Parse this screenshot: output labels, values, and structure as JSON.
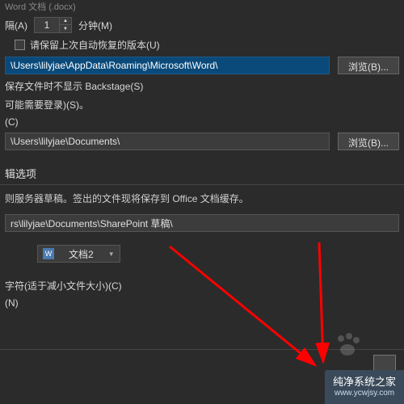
{
  "top_truncated": "Word 文档 (.docx)",
  "interval": {
    "label_left": "隔(A)",
    "value": "1",
    "label_right": "分钟(M)"
  },
  "keep_last_autorecover": "请保留上次自动恢复的版本(U)",
  "path1": "\\Users\\lilyjae\\AppData\\Roaming\\Microsoft\\Word\\",
  "browse_label": "浏览(B)...",
  "dont_show_backstage": "保存文件时不显示 Backstage(S)",
  "may_need_login": "可能需要登录)(S)。",
  "location_c": "(C)",
  "path2": "\\Users\\lilyjae\\Documents\\",
  "section_header": "辑选项",
  "section_text": "则服务器草稿。签出的文件现将保存到 Office 文档缓存。",
  "path3": "rs\\lilyjae\\Documents\\SharePoint 草稿\\",
  "dropdown": {
    "icon_text": "W",
    "label": "文档2"
  },
  "option_reduce": "字符(适于减小文件大小)(C)",
  "option_n": "(N)",
  "watermark": {
    "title": "纯净系统之家",
    "url": "www.ycwjsy.com"
  }
}
